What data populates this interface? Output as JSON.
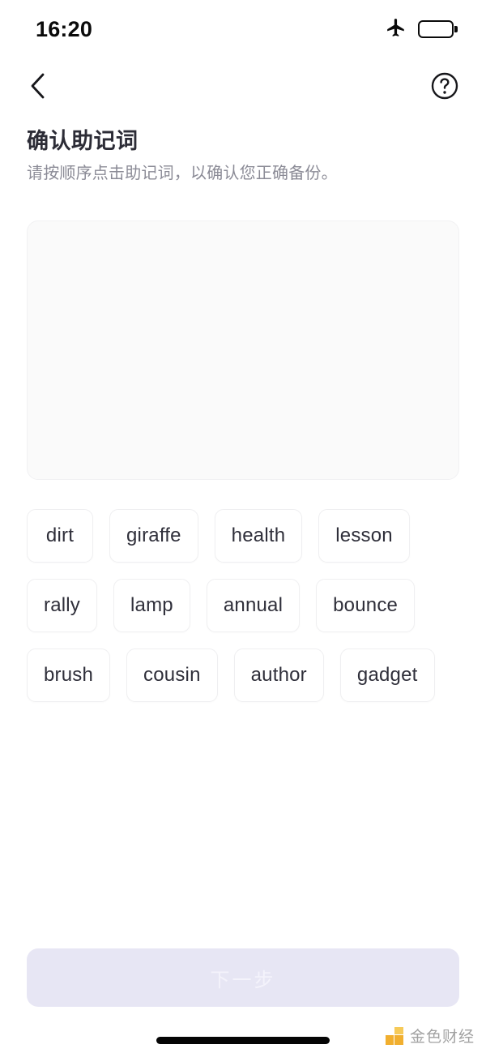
{
  "status_bar": {
    "time": "16:20",
    "airplane_icon": "airplane-mode-icon",
    "battery_icon": "battery-low-power-icon",
    "battery_level_percent": 45,
    "battery_fill_color": "#fcc900"
  },
  "nav_bar": {
    "back_icon": "chevron-left-icon",
    "help_icon": "question-mark-circle-icon"
  },
  "header": {
    "title": "确认助记词",
    "subtitle": "请按顺序点击助记词，以确认您正确备份。"
  },
  "answer_panel": {
    "selected_words": []
  },
  "word_bank": {
    "words": [
      "dirt",
      "giraffe",
      "health",
      "lesson",
      "rally",
      "lamp",
      "annual",
      "bounce",
      "brush",
      "cousin",
      "author",
      "gadget"
    ]
  },
  "footer": {
    "next_button_label": "下一步",
    "next_button_enabled": false,
    "watermark_text": "金色财经"
  },
  "colors": {
    "accent_disabled": "#e7e6f4",
    "panel_background": "#fafafa",
    "chip_background": "#ffffff",
    "title_text": "#2c2c36",
    "subtitle_text": "#8b8b96",
    "watermark_orange": "#f0a91e"
  }
}
